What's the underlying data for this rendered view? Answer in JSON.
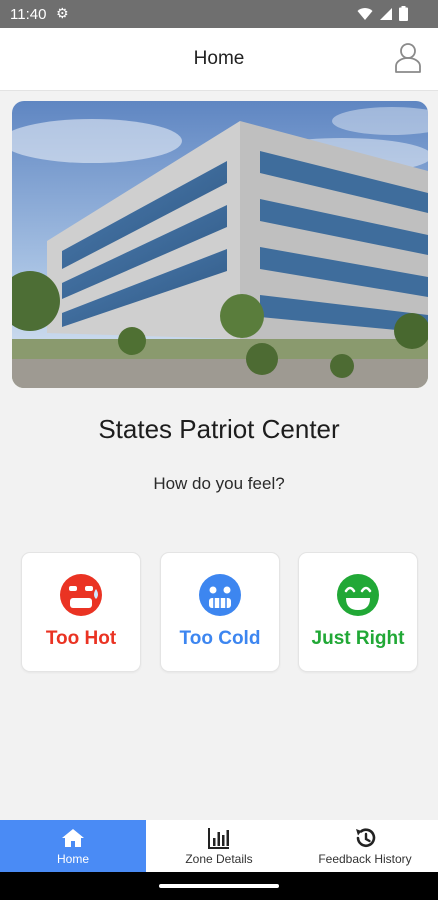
{
  "status_bar": {
    "time": "11:40",
    "icons": [
      "settings-icon",
      "wifi-icon",
      "signal-icon",
      "battery-icon"
    ]
  },
  "header": {
    "title": "Home",
    "profile_icon": "user-icon"
  },
  "building": {
    "name": "States Patriot Center"
  },
  "feedback": {
    "prompt": "How do you feel?",
    "options": [
      {
        "label": "Too Hot",
        "icon": "hot-face-icon",
        "color": "#ea3323"
      },
      {
        "label": "Too Cold",
        "icon": "cold-face-icon",
        "color": "#3d86f0"
      },
      {
        "label": "Just Right",
        "icon": "happy-face-icon",
        "color": "#21a836"
      }
    ]
  },
  "bottom_nav": {
    "active_color": "#4a8bf5",
    "items": [
      {
        "label": "Home",
        "icon": "home-icon",
        "active": true
      },
      {
        "label": "Zone Details",
        "icon": "bar-chart-icon",
        "active": false
      },
      {
        "label": "Feedback History",
        "icon": "history-icon",
        "active": false
      }
    ]
  }
}
